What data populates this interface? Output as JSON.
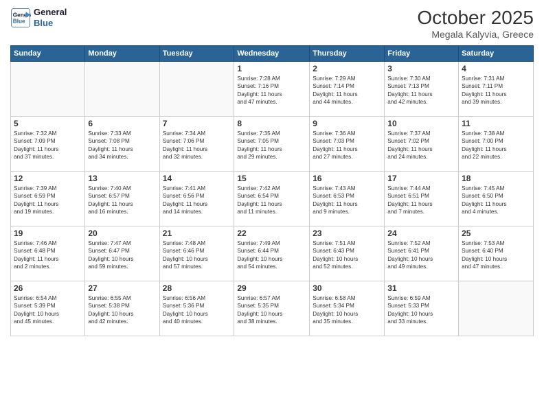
{
  "logo": {
    "line1": "General",
    "line2": "Blue"
  },
  "header": {
    "month": "October 2025",
    "location": "Megala Kalyvia, Greece"
  },
  "days_of_week": [
    "Sunday",
    "Monday",
    "Tuesday",
    "Wednesday",
    "Thursday",
    "Friday",
    "Saturday"
  ],
  "weeks": [
    [
      {
        "num": "",
        "info": ""
      },
      {
        "num": "",
        "info": ""
      },
      {
        "num": "",
        "info": ""
      },
      {
        "num": "1",
        "info": "Sunrise: 7:28 AM\nSunset: 7:16 PM\nDaylight: 11 hours\nand 47 minutes."
      },
      {
        "num": "2",
        "info": "Sunrise: 7:29 AM\nSunset: 7:14 PM\nDaylight: 11 hours\nand 44 minutes."
      },
      {
        "num": "3",
        "info": "Sunrise: 7:30 AM\nSunset: 7:13 PM\nDaylight: 11 hours\nand 42 minutes."
      },
      {
        "num": "4",
        "info": "Sunrise: 7:31 AM\nSunset: 7:11 PM\nDaylight: 11 hours\nand 39 minutes."
      }
    ],
    [
      {
        "num": "5",
        "info": "Sunrise: 7:32 AM\nSunset: 7:09 PM\nDaylight: 11 hours\nand 37 minutes."
      },
      {
        "num": "6",
        "info": "Sunrise: 7:33 AM\nSunset: 7:08 PM\nDaylight: 11 hours\nand 34 minutes."
      },
      {
        "num": "7",
        "info": "Sunrise: 7:34 AM\nSunset: 7:06 PM\nDaylight: 11 hours\nand 32 minutes."
      },
      {
        "num": "8",
        "info": "Sunrise: 7:35 AM\nSunset: 7:05 PM\nDaylight: 11 hours\nand 29 minutes."
      },
      {
        "num": "9",
        "info": "Sunrise: 7:36 AM\nSunset: 7:03 PM\nDaylight: 11 hours\nand 27 minutes."
      },
      {
        "num": "10",
        "info": "Sunrise: 7:37 AM\nSunset: 7:02 PM\nDaylight: 11 hours\nand 24 minutes."
      },
      {
        "num": "11",
        "info": "Sunrise: 7:38 AM\nSunset: 7:00 PM\nDaylight: 11 hours\nand 22 minutes."
      }
    ],
    [
      {
        "num": "12",
        "info": "Sunrise: 7:39 AM\nSunset: 6:59 PM\nDaylight: 11 hours\nand 19 minutes."
      },
      {
        "num": "13",
        "info": "Sunrise: 7:40 AM\nSunset: 6:57 PM\nDaylight: 11 hours\nand 16 minutes."
      },
      {
        "num": "14",
        "info": "Sunrise: 7:41 AM\nSunset: 6:56 PM\nDaylight: 11 hours\nand 14 minutes."
      },
      {
        "num": "15",
        "info": "Sunrise: 7:42 AM\nSunset: 6:54 PM\nDaylight: 11 hours\nand 11 minutes."
      },
      {
        "num": "16",
        "info": "Sunrise: 7:43 AM\nSunset: 6:53 PM\nDaylight: 11 hours\nand 9 minutes."
      },
      {
        "num": "17",
        "info": "Sunrise: 7:44 AM\nSunset: 6:51 PM\nDaylight: 11 hours\nand 7 minutes."
      },
      {
        "num": "18",
        "info": "Sunrise: 7:45 AM\nSunset: 6:50 PM\nDaylight: 11 hours\nand 4 minutes."
      }
    ],
    [
      {
        "num": "19",
        "info": "Sunrise: 7:46 AM\nSunset: 6:48 PM\nDaylight: 11 hours\nand 2 minutes."
      },
      {
        "num": "20",
        "info": "Sunrise: 7:47 AM\nSunset: 6:47 PM\nDaylight: 10 hours\nand 59 minutes."
      },
      {
        "num": "21",
        "info": "Sunrise: 7:48 AM\nSunset: 6:46 PM\nDaylight: 10 hours\nand 57 minutes."
      },
      {
        "num": "22",
        "info": "Sunrise: 7:49 AM\nSunset: 6:44 PM\nDaylight: 10 hours\nand 54 minutes."
      },
      {
        "num": "23",
        "info": "Sunrise: 7:51 AM\nSunset: 6:43 PM\nDaylight: 10 hours\nand 52 minutes."
      },
      {
        "num": "24",
        "info": "Sunrise: 7:52 AM\nSunset: 6:41 PM\nDaylight: 10 hours\nand 49 minutes."
      },
      {
        "num": "25",
        "info": "Sunrise: 7:53 AM\nSunset: 6:40 PM\nDaylight: 10 hours\nand 47 minutes."
      }
    ],
    [
      {
        "num": "26",
        "info": "Sunrise: 6:54 AM\nSunset: 5:39 PM\nDaylight: 10 hours\nand 45 minutes."
      },
      {
        "num": "27",
        "info": "Sunrise: 6:55 AM\nSunset: 5:38 PM\nDaylight: 10 hours\nand 42 minutes."
      },
      {
        "num": "28",
        "info": "Sunrise: 6:56 AM\nSunset: 5:36 PM\nDaylight: 10 hours\nand 40 minutes."
      },
      {
        "num": "29",
        "info": "Sunrise: 6:57 AM\nSunset: 5:35 PM\nDaylight: 10 hours\nand 38 minutes."
      },
      {
        "num": "30",
        "info": "Sunrise: 6:58 AM\nSunset: 5:34 PM\nDaylight: 10 hours\nand 35 minutes."
      },
      {
        "num": "31",
        "info": "Sunrise: 6:59 AM\nSunset: 5:33 PM\nDaylight: 10 hours\nand 33 minutes."
      },
      {
        "num": "",
        "info": ""
      }
    ]
  ]
}
